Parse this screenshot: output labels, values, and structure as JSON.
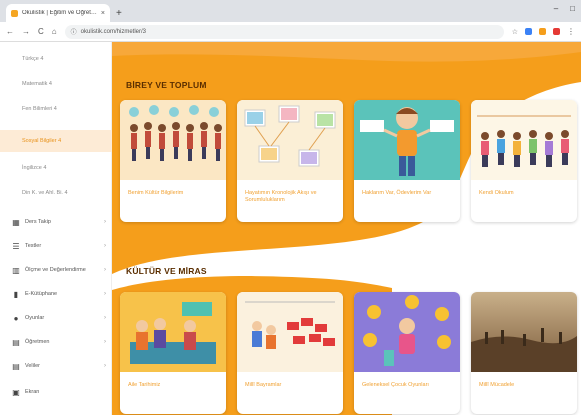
{
  "browser": {
    "tab_title": "Okulistik | Eğitim ve Öğretime Y...",
    "tab_close": "×",
    "new_tab": "+",
    "win_min": "–",
    "win_max": "□",
    "win_close": "×",
    "url": "okulistik.com/hizmetler/3",
    "back": "←",
    "forward": "→",
    "reload": "C",
    "home": "⌂"
  },
  "sidebar": {
    "items": [
      {
        "label": "Türkçe 4"
      },
      {
        "label": "Matematik 4"
      },
      {
        "label": "Fen Bilimleri 4"
      },
      {
        "label": "Sosyal Bilgiler 4"
      },
      {
        "label": "İngilizce 4"
      },
      {
        "label": "Din K. ve Ahl. Bi. 4"
      }
    ],
    "sections": [
      {
        "label": "Ders Takip"
      },
      {
        "label": "Testler"
      },
      {
        "label": "Ölçme ve Değerlendirme"
      },
      {
        "label": "E-Kütüphane"
      },
      {
        "label": "Oyunlar"
      },
      {
        "label": "Öğretmen"
      },
      {
        "label": "Veliler"
      },
      {
        "label": "Ekran"
      }
    ],
    "chevron": "›"
  },
  "main": {
    "sections": [
      {
        "title": "BİREY VE TOPLUM",
        "cards": [
          {
            "label": "Benim Kültür Bilgilerim"
          },
          {
            "label": "Hayatımın Kronolojik Akışı ve Sorumluluklarım"
          },
          {
            "label": "Haklarım Var, Ödevlerim Var"
          },
          {
            "label": "Kendi Okulum"
          }
        ]
      },
      {
        "title": "KÜLTÜR VE MİRAS",
        "cards": [
          {
            "label": "Aile Tarihimiz"
          },
          {
            "label": "Millî Bayramlar"
          },
          {
            "label": "Geleneksel Çocuk Oyunları"
          },
          {
            "label": "Millî Mücadele"
          }
        ]
      }
    ]
  },
  "colors": {
    "accent": "#f59e1b",
    "active_bg": "#fdebd6",
    "card_label": "#f0a030",
    "title": "#5a2e00"
  }
}
